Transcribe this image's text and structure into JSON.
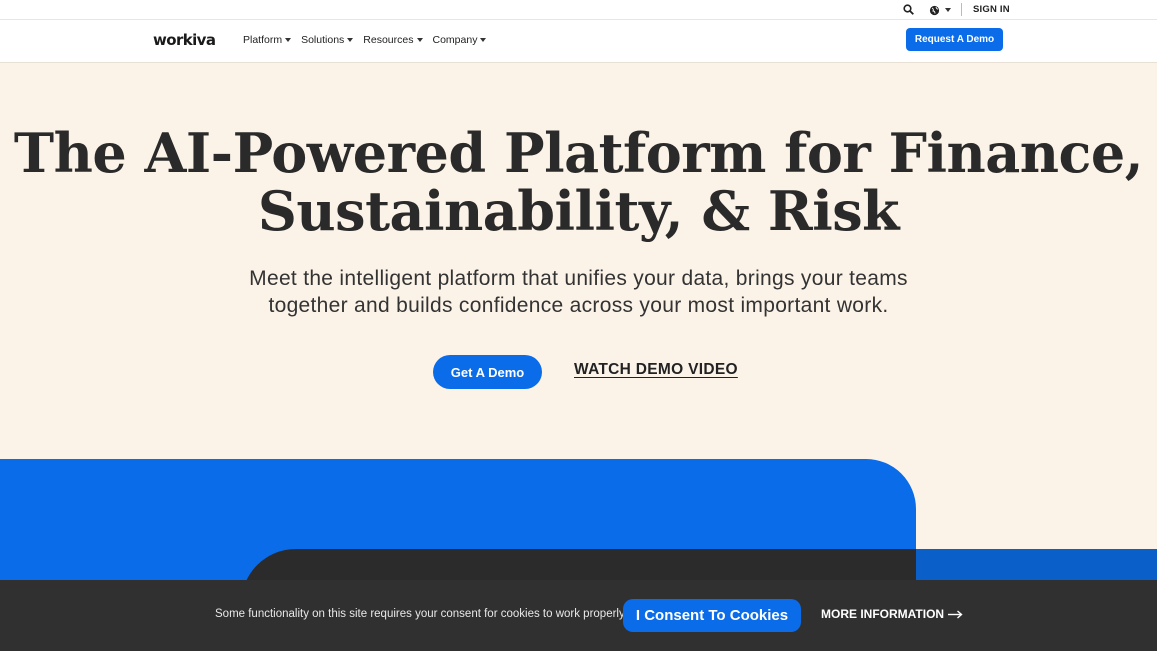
{
  "utility": {
    "search_icon": "search-icon",
    "globe_icon": "globe-icon",
    "sign_in": "SIGN IN"
  },
  "nav": {
    "logo": "workiva",
    "items": [
      {
        "label": "Platform"
      },
      {
        "label": "Solutions"
      },
      {
        "label": "Resources"
      },
      {
        "label": "Company"
      }
    ],
    "cta": "Request A Demo"
  },
  "hero": {
    "title_line1": "The AI-Powered Platform for Finance,",
    "title_line2": "Sustainability, & Risk",
    "subtitle_line1": "Meet the intelligent platform that unifies your data, brings your teams",
    "subtitle_line2": "together and builds confidence across your most important work.",
    "primary_cta": "Get A Demo",
    "secondary_cta": "WATCH DEMO VIDEO"
  },
  "cookie": {
    "message": "Some functionality on this site requires your consent for cookies to work properly.",
    "consent_button": "I Consent To Cookies",
    "more_info": "MORE INFORMATION"
  },
  "colors": {
    "accent": "#0a6ce8",
    "hero_bg": "#fbf3e8",
    "cookie_bg": "#303030"
  }
}
